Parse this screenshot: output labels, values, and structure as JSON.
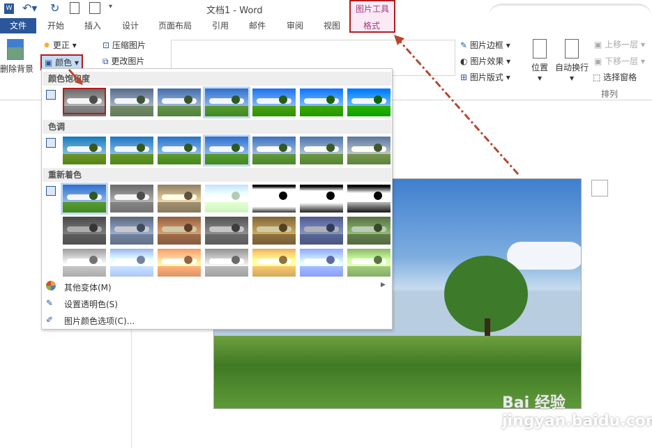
{
  "title": "文档1 - Word",
  "quick_access": {
    "undo": "undo-icon",
    "redo": "redo-icon"
  },
  "context_tab_group": "图片工具",
  "tabs": [
    "文件",
    "开始",
    "插入",
    "设计",
    "页面布局",
    "引用",
    "邮件",
    "审阅",
    "视图",
    "格式"
  ],
  "ribbon": {
    "remove_bg": "删除背景",
    "corrections": "更正",
    "color": "颜色",
    "compress": "压缩图片",
    "change": "更改图片",
    "border": "图片边框",
    "effects": "图片效果",
    "layout": "图片版式",
    "position": "位置",
    "wrap": "自动换行",
    "forward": "上移一层",
    "backward": "下移一层",
    "selection_pane": "选择窗格",
    "arrange_group": "排列"
  },
  "dropdown": {
    "saturation": "颜色饱和度",
    "tone": "色调",
    "recolor": "重新着色",
    "more": "其他变体(M)",
    "transparent": "设置透明色(S)",
    "options": "图片颜色选项(C)..."
  },
  "colors": {
    "accent": "#2b579a",
    "context": "#a4377e",
    "highlight": "#b31b1b"
  },
  "watermark": "Bai 经验 jingyan.baidu.com"
}
